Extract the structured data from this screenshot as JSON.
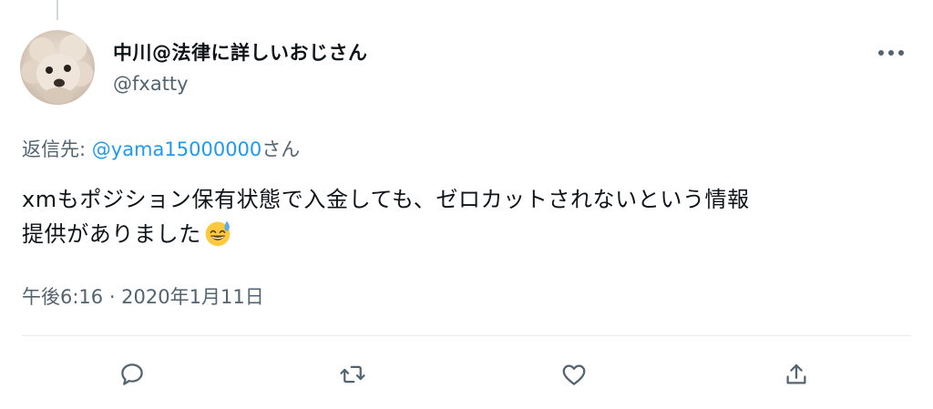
{
  "tweet": {
    "display_name": "中川@法律に詳しいおじさん",
    "handle": "@fxatty",
    "reply_prefix": "返信先: ",
    "reply_mention": "@yama15000000",
    "reply_suffix": "さん",
    "text_line1": "xmもポジション保有状態で入金しても、ゼロカットされないという情報",
    "text_line2": "提供がありました",
    "emoji": "grinning-face-with-sweat",
    "timestamp": "午後6:16 · 2020年1月11日"
  },
  "icons": {
    "more": "more-horizontal-icon",
    "reply": "reply-icon",
    "retweet": "retweet-icon",
    "like": "like-icon",
    "share": "share-icon"
  },
  "colors": {
    "text": "#0f1419",
    "secondary": "#536471",
    "mention": "#1d9bf0",
    "divider": "#e6ecf0"
  }
}
